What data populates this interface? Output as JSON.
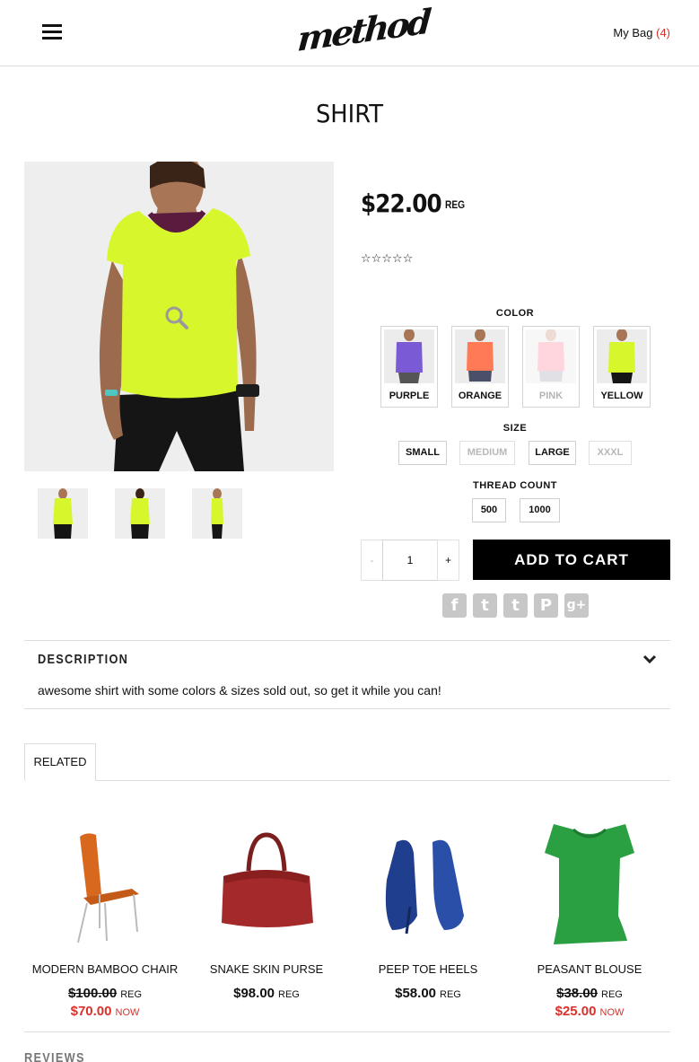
{
  "header": {
    "logo_text": "method",
    "mybag_label": "My Bag",
    "mybag_count": "(4)"
  },
  "product": {
    "title": "SHIRT",
    "price": "$22.00",
    "price_tag": "REG",
    "rating_stars": "☆☆☆☆☆",
    "color_label": "COLOR",
    "colors": [
      {
        "label": "PURPLE",
        "swatch": "#7b5ad6",
        "sold_out": false
      },
      {
        "label": "ORANGE",
        "swatch": "#ff7a55",
        "sold_out": false
      },
      {
        "label": "PINK",
        "swatch": "#ffb3c4",
        "sold_out": true
      },
      {
        "label": "YELLOW",
        "swatch": "#d9f52a",
        "sold_out": false
      }
    ],
    "size_label": "SIZE",
    "sizes": [
      {
        "label": "SMALL",
        "sold_out": false
      },
      {
        "label": "MEDIUM",
        "sold_out": true
      },
      {
        "label": "LARGE",
        "sold_out": false
      },
      {
        "label": "XXXL",
        "sold_out": true
      }
    ],
    "thread_label": "THREAD COUNT",
    "threads": [
      {
        "label": "500"
      },
      {
        "label": "1000"
      }
    ],
    "qty_minus": "-",
    "qty_value": "1",
    "qty_plus": "+",
    "add_to_cart": "ADD TO CART",
    "social": [
      {
        "name": "facebook",
        "glyph": "f"
      },
      {
        "name": "twitter",
        "glyph": "t"
      },
      {
        "name": "tumblr",
        "glyph": "t"
      },
      {
        "name": "pinterest",
        "glyph": "P"
      },
      {
        "name": "google-plus",
        "glyph": "g+"
      }
    ]
  },
  "description": {
    "title": "DESCRIPTION",
    "text": "awesome shirt with some colors & sizes sold out, so get it while you can!"
  },
  "related": {
    "tab_label": "RELATED",
    "items": [
      {
        "name": "MODERN BAMBOO CHAIR",
        "old_price": "$100.00",
        "old_tag": "REG",
        "sale_price": "$70.00",
        "sale_tag": "NOW"
      },
      {
        "name": "SNAKE SKIN PURSE",
        "price": "$98.00",
        "price_tag": "REG"
      },
      {
        "name": "PEEP TOE HEELS",
        "price": "$58.00",
        "price_tag": "REG"
      },
      {
        "name": "PEASANT BLOUSE",
        "old_price": "$38.00",
        "old_tag": "REG",
        "sale_price": "$25.00",
        "sale_tag": "NOW"
      }
    ]
  },
  "reviews_title": "REVIEWS",
  "colors": {
    "accent_red": "#d9302b",
    "button_black": "#000000",
    "social_gray": "#c7c7c7"
  }
}
